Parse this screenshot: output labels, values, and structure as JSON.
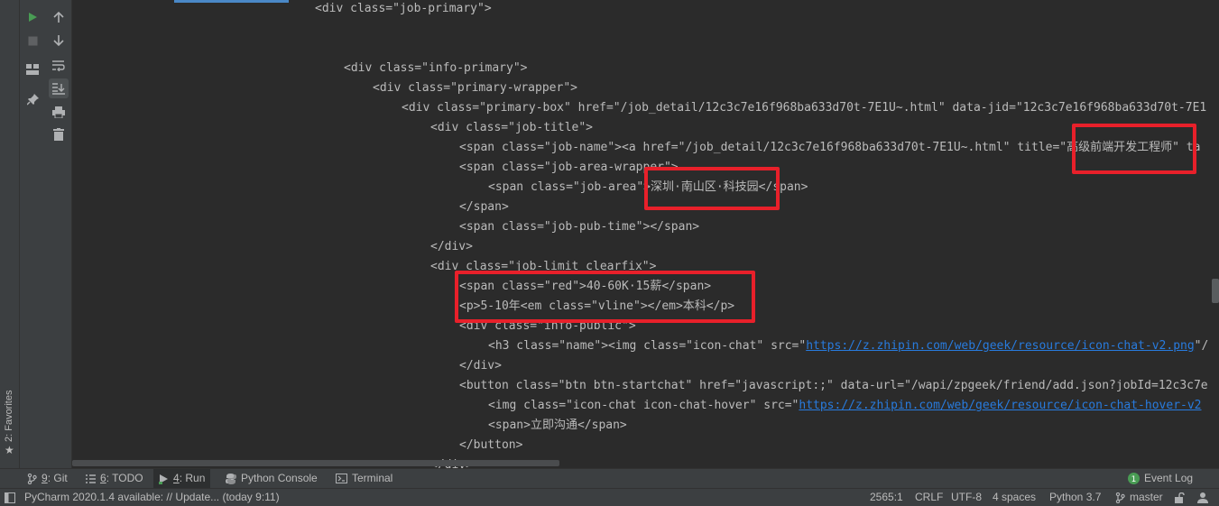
{
  "favorites": {
    "label": "2: Favorites"
  },
  "code_lines": [
    {
      "text": "<div class=\"job-primary\">"
    },
    {
      "text": "<div class=\"info-primary\">"
    },
    {
      "text": "<div class=\"primary-wrapper\">"
    },
    {
      "text": "<div class=\"primary-box\" href=\"/job_detail/12c3c7e16f968ba633d70t-7E1U~.html\" data-jid=\"12c3c7e16f968ba633d70t-7E1"
    },
    {
      "text": "<div class=\"job-title\">"
    },
    {
      "text": "<span class=\"job-name\"><a href=\"/job_detail/12c3c7e16f968ba633d70t-7E1U~.html\" title=\"高级前端开发工程师\" ta"
    },
    {
      "text": "<span class=\"job-area-wrapper\">"
    },
    {
      "text": "<span class=\"job-area\">深圳·南山区·科技园</span>"
    },
    {
      "text": "</span>"
    },
    {
      "text": "<span class=\"job-pub-time\"></span>"
    },
    {
      "text": "</div>"
    },
    {
      "text": "<div class=\"job-limit clearfix\">"
    },
    {
      "text": "<span class=\"red\">40-60K·15薪</span>"
    },
    {
      "text": "<p>5-10年<em class=\"vline\"></em>本科</p>"
    },
    {
      "text": "<div class=\"info-public\">"
    },
    {
      "prefix": "<h3 class=\"name\"><img class=\"icon-chat\" src=\"",
      "link": "https://z.zhipin.com/web/geek/resource/icon-chat-v2.png",
      "suffix": "\"/"
    },
    {
      "text": "</div>"
    },
    {
      "text": "<button class=\"btn btn-startchat\" href=\"javascript:;\" data-url=\"/wapi/zpgeek/friend/add.json?jobId=12c3c7e"
    },
    {
      "prefix": "<img class=\"icon-chat icon-chat-hover\" src=\"",
      "link": "https://z.zhipin.com/web/geek/resource/icon-chat-hover-v2",
      "suffix": ""
    },
    {
      "text": "<span>立即沟通</span>"
    },
    {
      "text": "</button>"
    },
    {
      "text": "</div>"
    }
  ],
  "tool_tabs": [
    {
      "mnemonic": "9",
      "label": ": Git"
    },
    {
      "mnemonic": "6",
      "label": ": TODO"
    },
    {
      "mnemonic": "4",
      "label": ": Run"
    },
    {
      "mnemonic": "",
      "label": "Python Console"
    },
    {
      "mnemonic": "",
      "label": "Terminal"
    }
  ],
  "event_log": "Event Log",
  "status": {
    "message": "PyCharm 2020.1.4 available: // Update... (today 9:11)",
    "position": "2565:1",
    "line_sep": "CRLF",
    "encoding": "UTF-8",
    "indent": "4 spaces",
    "interpreter": "Python 3.7",
    "branch": "master"
  },
  "colors": {
    "highlight": "#e8202a",
    "link": "#287bde",
    "run": "#499c54"
  }
}
